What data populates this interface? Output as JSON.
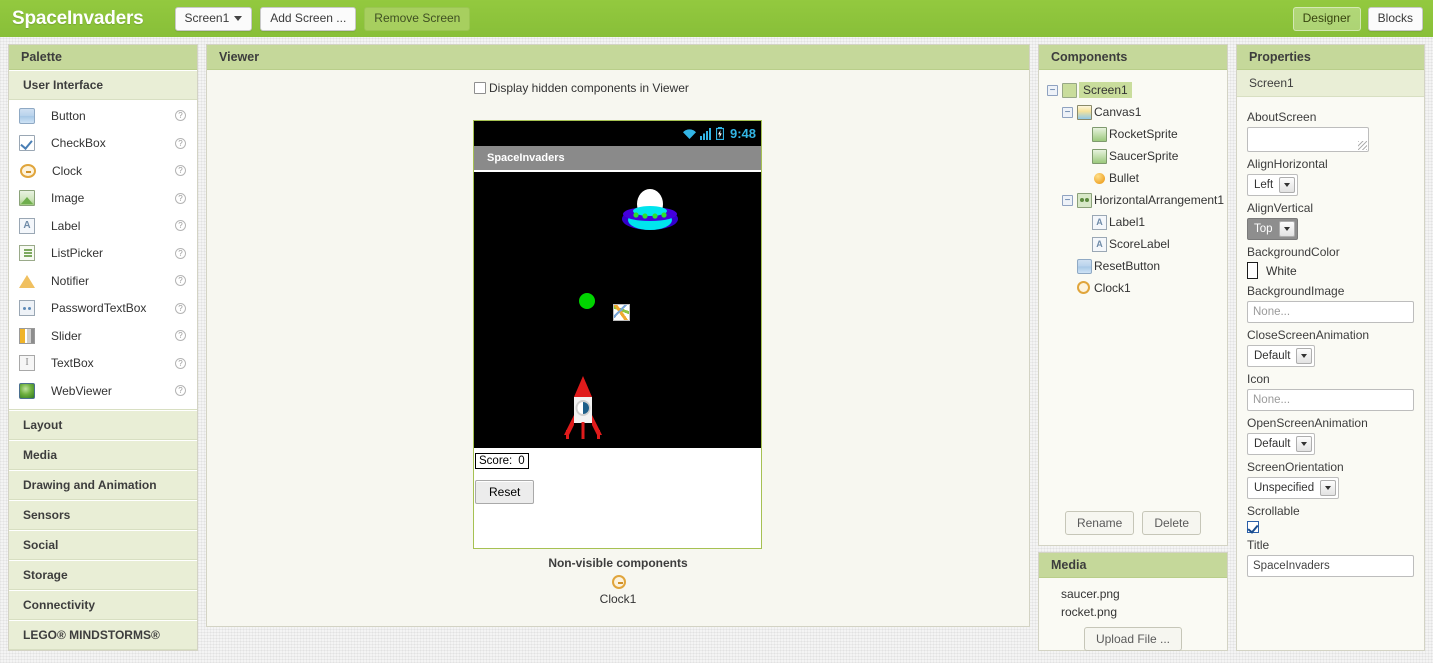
{
  "topbar": {
    "app_title": "SpaceInvaders",
    "screen_selector": "Screen1",
    "add_screen": "Add Screen ...",
    "remove_screen": "Remove Screen",
    "designer": "Designer",
    "blocks": "Blocks"
  },
  "palette": {
    "header": "Palette",
    "sections": [
      {
        "title": "User Interface",
        "open": true,
        "items": [
          {
            "label": "Button",
            "icon": "button-icon"
          },
          {
            "label": "CheckBox",
            "icon": "checkbox-icon"
          },
          {
            "label": "Clock",
            "icon": "clock-icon"
          },
          {
            "label": "Image",
            "icon": "image-icon"
          },
          {
            "label": "Label",
            "icon": "label-icon"
          },
          {
            "label": "ListPicker",
            "icon": "listpicker-icon"
          },
          {
            "label": "Notifier",
            "icon": "notifier-icon"
          },
          {
            "label": "PasswordTextBox",
            "icon": "password-icon"
          },
          {
            "label": "Slider",
            "icon": "slider-icon"
          },
          {
            "label": "TextBox",
            "icon": "textbox-icon"
          },
          {
            "label": "WebViewer",
            "icon": "webviewer-icon"
          }
        ]
      },
      {
        "title": "Layout",
        "open": false,
        "items": []
      },
      {
        "title": "Media",
        "open": false,
        "items": []
      },
      {
        "title": "Drawing and Animation",
        "open": false,
        "items": []
      },
      {
        "title": "Sensors",
        "open": false,
        "items": []
      },
      {
        "title": "Social",
        "open": false,
        "items": []
      },
      {
        "title": "Storage",
        "open": false,
        "items": []
      },
      {
        "title": "Connectivity",
        "open": false,
        "items": []
      },
      {
        "title": "LEGO® MINDSTORMS®",
        "open": false,
        "items": []
      }
    ],
    "help_glyph": "?"
  },
  "viewer": {
    "header": "Viewer",
    "display_hidden_label": "Display hidden components in Viewer",
    "display_hidden_checked": false,
    "phone": {
      "status_time": "9:48",
      "title": "SpaceInvaders",
      "score_label": "Score:",
      "score_value": "0",
      "reset_button": "Reset"
    },
    "nonvisible_title": "Non-visible components",
    "nonvisible_items": [
      {
        "label": "Clock1",
        "icon": "clock-icon"
      }
    ]
  },
  "components": {
    "header": "Components",
    "tree": [
      {
        "label": "Screen1",
        "depth": 0,
        "expander": "−",
        "icon": "screen-icon",
        "selected": true
      },
      {
        "label": "Canvas1",
        "depth": 1,
        "expander": "−",
        "icon": "canvas-icon",
        "selected": false
      },
      {
        "label": "RocketSprite",
        "depth": 2,
        "expander": "",
        "icon": "sprite-icon",
        "selected": false
      },
      {
        "label": "SaucerSprite",
        "depth": 2,
        "expander": "",
        "icon": "sprite-icon",
        "selected": false
      },
      {
        "label": "Bullet",
        "depth": 2,
        "expander": "",
        "icon": "ball-icon",
        "selected": false
      },
      {
        "label": "HorizontalArrangement1",
        "depth": 1,
        "expander": "−",
        "icon": "horizontal-arrangement-icon",
        "selected": false
      },
      {
        "label": "Label1",
        "depth": 2,
        "expander": "",
        "icon": "label-icon",
        "selected": false
      },
      {
        "label": "ScoreLabel",
        "depth": 2,
        "expander": "",
        "icon": "label-icon",
        "selected": false
      },
      {
        "label": "ResetButton",
        "depth": 1,
        "expander": "",
        "icon": "button-icon",
        "selected": false
      },
      {
        "label": "Clock1",
        "depth": 1,
        "expander": "",
        "icon": "clock-icon",
        "selected": false
      }
    ],
    "rename_button": "Rename",
    "delete_button": "Delete"
  },
  "media": {
    "header": "Media",
    "files": [
      "saucer.png",
      "rocket.png"
    ],
    "upload_button": "Upload File ..."
  },
  "properties": {
    "header": "Properties",
    "subject": "Screen1",
    "items": [
      {
        "name": "AboutScreen",
        "type": "textarea",
        "value": ""
      },
      {
        "name": "AlignHorizontal",
        "type": "select",
        "value": "Left",
        "active": false
      },
      {
        "name": "AlignVertical",
        "type": "select",
        "value": "Top",
        "active": true
      },
      {
        "name": "BackgroundColor",
        "type": "color",
        "value": "White",
        "swatch": "#ffffff"
      },
      {
        "name": "BackgroundImage",
        "type": "text",
        "value": "None..."
      },
      {
        "name": "CloseScreenAnimation",
        "type": "select",
        "value": "Default",
        "active": false
      },
      {
        "name": "Icon",
        "type": "text",
        "value": "None..."
      },
      {
        "name": "OpenScreenAnimation",
        "type": "select",
        "value": "Default",
        "active": false
      },
      {
        "name": "ScreenOrientation",
        "type": "select",
        "value": "Unspecified",
        "active": false
      },
      {
        "name": "Scrollable",
        "type": "checkbox",
        "value": "",
        "checked": true
      },
      {
        "name": "Title",
        "type": "text",
        "value": "SpaceInvaders"
      }
    ]
  },
  "colors": {
    "brand_green": "#8ec641",
    "panel_header": "#c5d89a",
    "section_bg": "#e9eed6",
    "canvas_black": "#000000",
    "bullet_green": "#00d400",
    "status_blue": "#33b5e5"
  }
}
